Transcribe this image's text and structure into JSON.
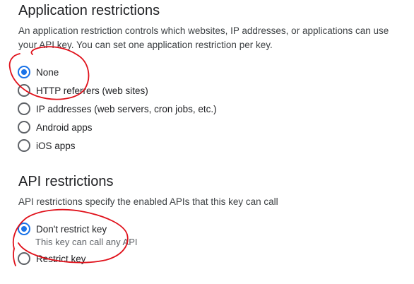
{
  "app_restrictions": {
    "title": "Application restrictions",
    "description": "An application restriction controls which websites, IP addresses, or applications can use your API key. You can set one application restriction per key.",
    "options": [
      {
        "label": "None",
        "checked": true
      },
      {
        "label": "HTTP referrers (web sites)",
        "checked": false
      },
      {
        "label": "IP addresses (web servers, cron jobs, etc.)",
        "checked": false
      },
      {
        "label": "Android apps",
        "checked": false
      },
      {
        "label": "iOS apps",
        "checked": false
      }
    ]
  },
  "api_restrictions": {
    "title": "API restrictions",
    "description": "API restrictions specify the enabled APIs that this key can call",
    "options": [
      {
        "label": "Don't restrict key",
        "sublabel": "This key can call any API",
        "checked": true
      },
      {
        "label": "Restrict key",
        "checked": false
      }
    ]
  },
  "colors": {
    "accent": "#1a73e8",
    "annotation": "#e0101a",
    "text": "#202124",
    "secondary_text": "#5f6368"
  }
}
